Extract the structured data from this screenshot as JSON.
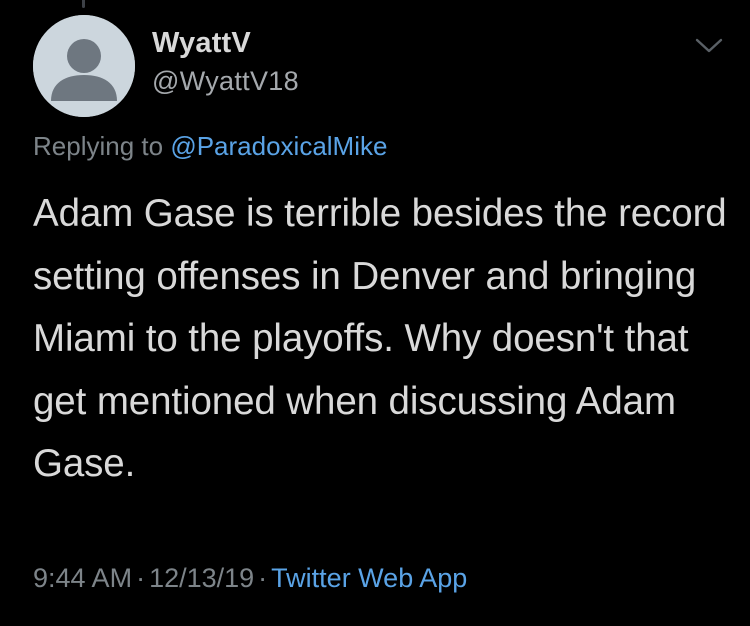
{
  "tweet": {
    "author": {
      "display_name": "WyattV",
      "handle": "@WyattV18",
      "avatar": "default-avatar-icon"
    },
    "reply": {
      "prefix": "Replying to",
      "mention": "@ParadoxicalMike"
    },
    "text": "Adam Gase is terrible besides the record setting offenses in Denver and bringing Miami to the playoffs. Why doesn't that get mentioned when discussing Adam Gase.",
    "time": "9:44 AM",
    "date": "12/13/19",
    "separator": "·",
    "source": "Twitter Web App",
    "menu_icon": "chevron-down-icon"
  },
  "colors": {
    "background": "#000000",
    "primary_text": "#d9d9d9",
    "secondary_text": "#7d8489",
    "link": "#5aa3e6",
    "avatar_bg": "#ccd6dd",
    "avatar_fg": "#6e7780"
  }
}
